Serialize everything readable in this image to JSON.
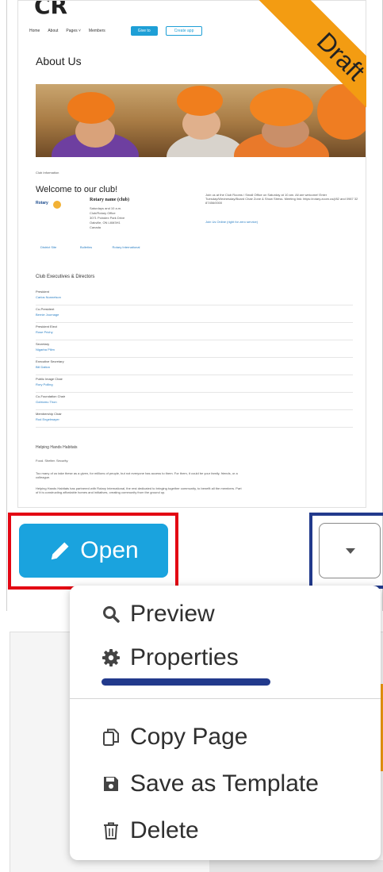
{
  "thumbnail": {
    "logo": "CR",
    "nav": [
      "Home",
      "About",
      "Pages ˅",
      "Members"
    ],
    "nav_button_primary": "Give to",
    "nav_button_secondary": "Create app",
    "page_title": "About Us",
    "club_info_label": "Club Information",
    "welcome": "Welcome to our club!",
    "rotary": "Rotary",
    "club_name": "Rotary name (club)",
    "address_lines": [
      "Saturdays and 10 a.m.",
      "Club/Rotary Office",
      "3071 Poindex Park Drive",
      "Oakville, ON L6M3H1",
      "Canada"
    ],
    "intro": "Join us at the Club Rooms / Small Office on Saturday at 10 am. All are welcome! Enter Tuesday/Wednesday/Board Chair Zone & Show Stress. Meeting link: https://rotary.zoom.us/j/82 and 0987 32 87456/0000",
    "join_link": "Join Us Online (right for zero service)",
    "quick_links": [
      "District Site",
      "Bulletins",
      "Rotary International"
    ],
    "exec_title": "Club Executives & Directors",
    "executives": [
      {
        "role": "President",
        "name": "Carlos Nunnelson"
      },
      {
        "role": "Co-President",
        "name": "Bernie Journage"
      },
      {
        "role": "President Elect",
        "name": "Rose Prichy"
      },
      {
        "role": "Secretary",
        "name": "Nigarba Pilim"
      },
      {
        "role": "Executive Secretary",
        "name": "Bill Dalton"
      },
      {
        "role": "Public Image Chair",
        "name": "Rory Polling"
      },
      {
        "role": "Co-Foundation Chair",
        "name": "Gobtomu Thon"
      },
      {
        "role": "Membership Chair",
        "name": "Rod Engelmayer"
      }
    ],
    "helping_title": "Helping Hands Habitats",
    "helping_sub": "Food. Shelter. Security.",
    "helping_p1": "Too many of us take these as a given, for millions of people, but not everyone has access to them. For them, it could be your family, friends, or a colleague.",
    "helping_p2": "Helping Hands Habitats has partnered with Rotary International, the rest dedicated to bringing together community, to benefit all the members. Part of it is constructing affordable homes and initiatives, creating community from the ground up."
  },
  "ribbon": "Draft",
  "open_button": "Open",
  "menu": {
    "preview": "Preview",
    "properties": "Properties",
    "copy_page": "Copy Page",
    "save_template": "Save as Template",
    "delete": "Delete"
  },
  "colors": {
    "primary": "#1aa3de",
    "highlight_red": "#e30613",
    "highlight_blue": "#223a8c",
    "ribbon": "#f39c12"
  }
}
